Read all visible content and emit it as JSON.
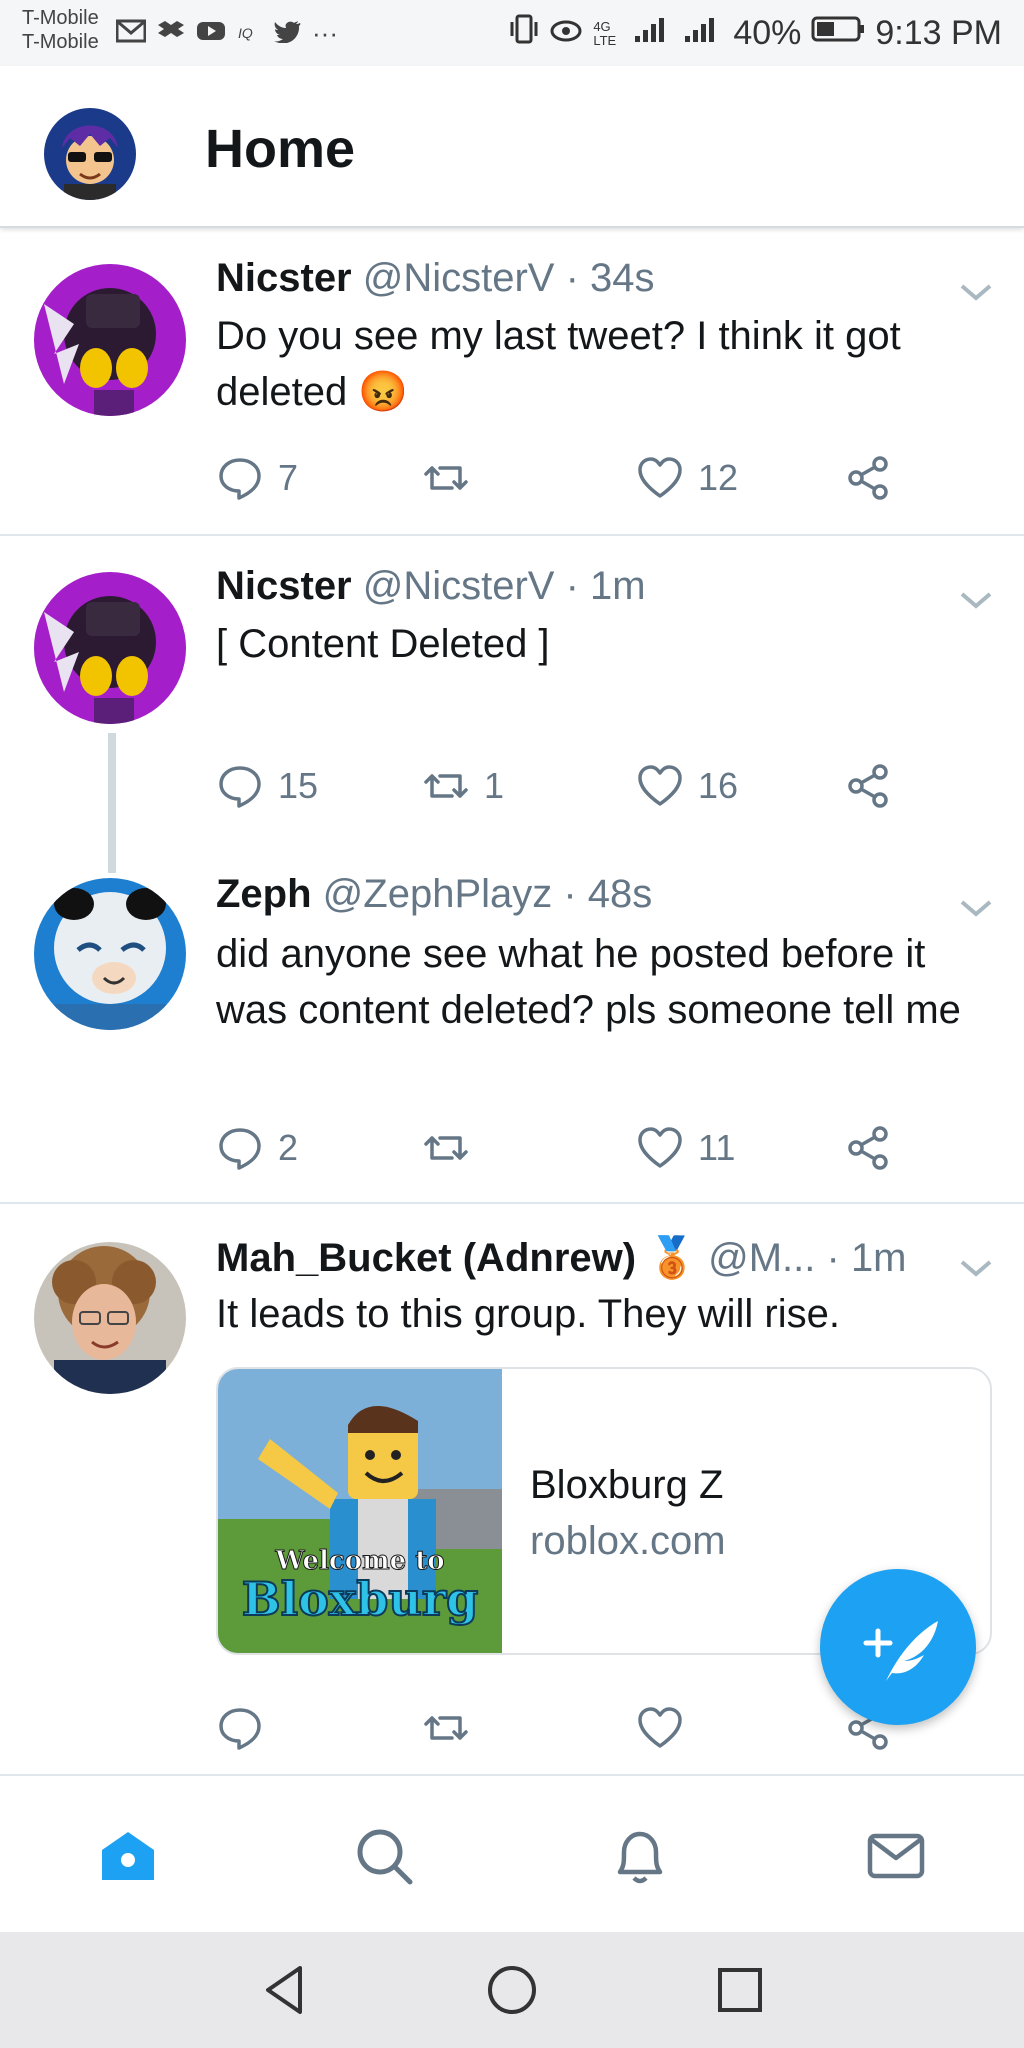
{
  "status_bar": {
    "carrier_1": "T-Mobile",
    "carrier_2": "T-Mobile",
    "network": "4G LTE",
    "battery": "40%",
    "time": "9:13 PM",
    "notif_more": "···"
  },
  "header": {
    "title": "Home"
  },
  "tweets": [
    {
      "name": "Nicster",
      "handle": "@NicsterV · 34s",
      "text": "Do you see my last tweet? I think it got deleted",
      "emoji": "😡",
      "replies": "7",
      "retweets": "",
      "likes": "12"
    },
    {
      "name": "Nicster",
      "handle": "@NicsterV · 1m",
      "text": "[ Content Deleted ]",
      "replies": "15",
      "retweets": "1",
      "likes": "16"
    },
    {
      "name": "Zeph",
      "handle": "@ZephPlayz · 48s",
      "text": "did anyone see what he posted before it was content deleted? pls someone tell me",
      "replies": "2",
      "retweets": "",
      "likes": "11"
    },
    {
      "name": "Mah_Bucket (Adnrew)",
      "badge": "🥉",
      "handle": "@M... · 1m",
      "text": "It leads to this group. They will rise.",
      "card": {
        "title": "Bloxburg Z",
        "domain": "roblox.com",
        "thumb_text_1": "Welcome to",
        "thumb_text_2": "Bloxburg"
      },
      "replies": "",
      "retweets": "",
      "likes": ""
    }
  ],
  "colors": {
    "accent": "#1da1f2",
    "muted": "#657786"
  }
}
